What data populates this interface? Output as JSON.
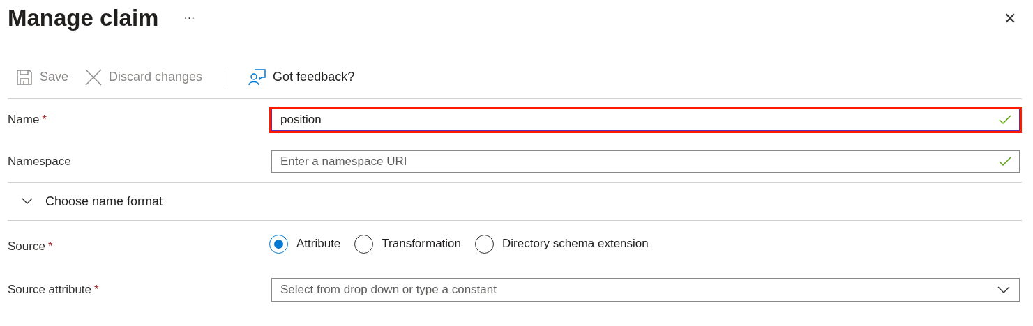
{
  "header": {
    "title": "Manage claim",
    "more": "···",
    "close": "✕"
  },
  "toolbar": [
    {
      "kind": "save",
      "label": "Save",
      "disabled": true
    },
    {
      "kind": "discard",
      "label": "Discard changes",
      "disabled": true
    },
    {
      "kind": "feedback",
      "label": "Got feedback?",
      "disabled": false
    }
  ],
  "fields": [
    {
      "label": "Name",
      "required_mark": "*",
      "value": "position",
      "valid": true,
      "highlighted": true
    },
    {
      "label": "Namespace",
      "placeholder": "Enter a namespace URI",
      "valid": true,
      "highlighted": false
    }
  ],
  "section": {
    "label": "Choose name format",
    "expanded": false
  },
  "source": {
    "label": "Source",
    "required_mark": "*",
    "options": [
      {
        "label": "Attribute",
        "selected": true
      },
      {
        "label": "Transformation",
        "selected": false
      },
      {
        "label": "Directory schema extension",
        "selected": false
      }
    ]
  },
  "source_attribute": {
    "label": "Source attribute",
    "required_mark": "*",
    "placeholder": "Select from drop down or type a constant"
  }
}
